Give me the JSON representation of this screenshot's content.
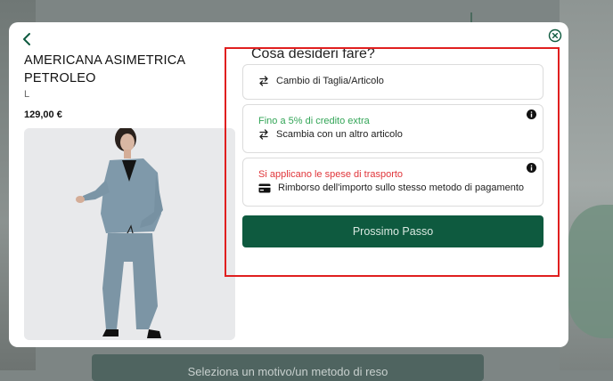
{
  "background": {
    "bottom_button_label": "Seleziona un motivo/un metodo di reso"
  },
  "product": {
    "title": "AMERICANA ASIMETRICA PETROLEO",
    "size": "L",
    "price": "129,00 €"
  },
  "question": "Cosa desideri fare?",
  "options": [
    {
      "note": "",
      "label": "Cambio di Taglia/Articolo",
      "icon": "swap-arrows-icon"
    },
    {
      "note": "Fino a 5% di credito extra",
      "label": "Scambia con un altro articolo",
      "icon": "swap-arrows-icon",
      "note_color": "#33a557"
    },
    {
      "note": "Si applicano le spese di trasporto",
      "label": "Rimborso dell'importo sullo stesso metodo di pagamento",
      "icon": "credit-card-icon",
      "note_color": "#e0353a"
    }
  ],
  "next_button": "Prossimo Passo",
  "colors": {
    "primary": "#0e5a3f",
    "highlight": "#e01f1f",
    "note_green": "#33a557",
    "note_red": "#e0353a"
  }
}
